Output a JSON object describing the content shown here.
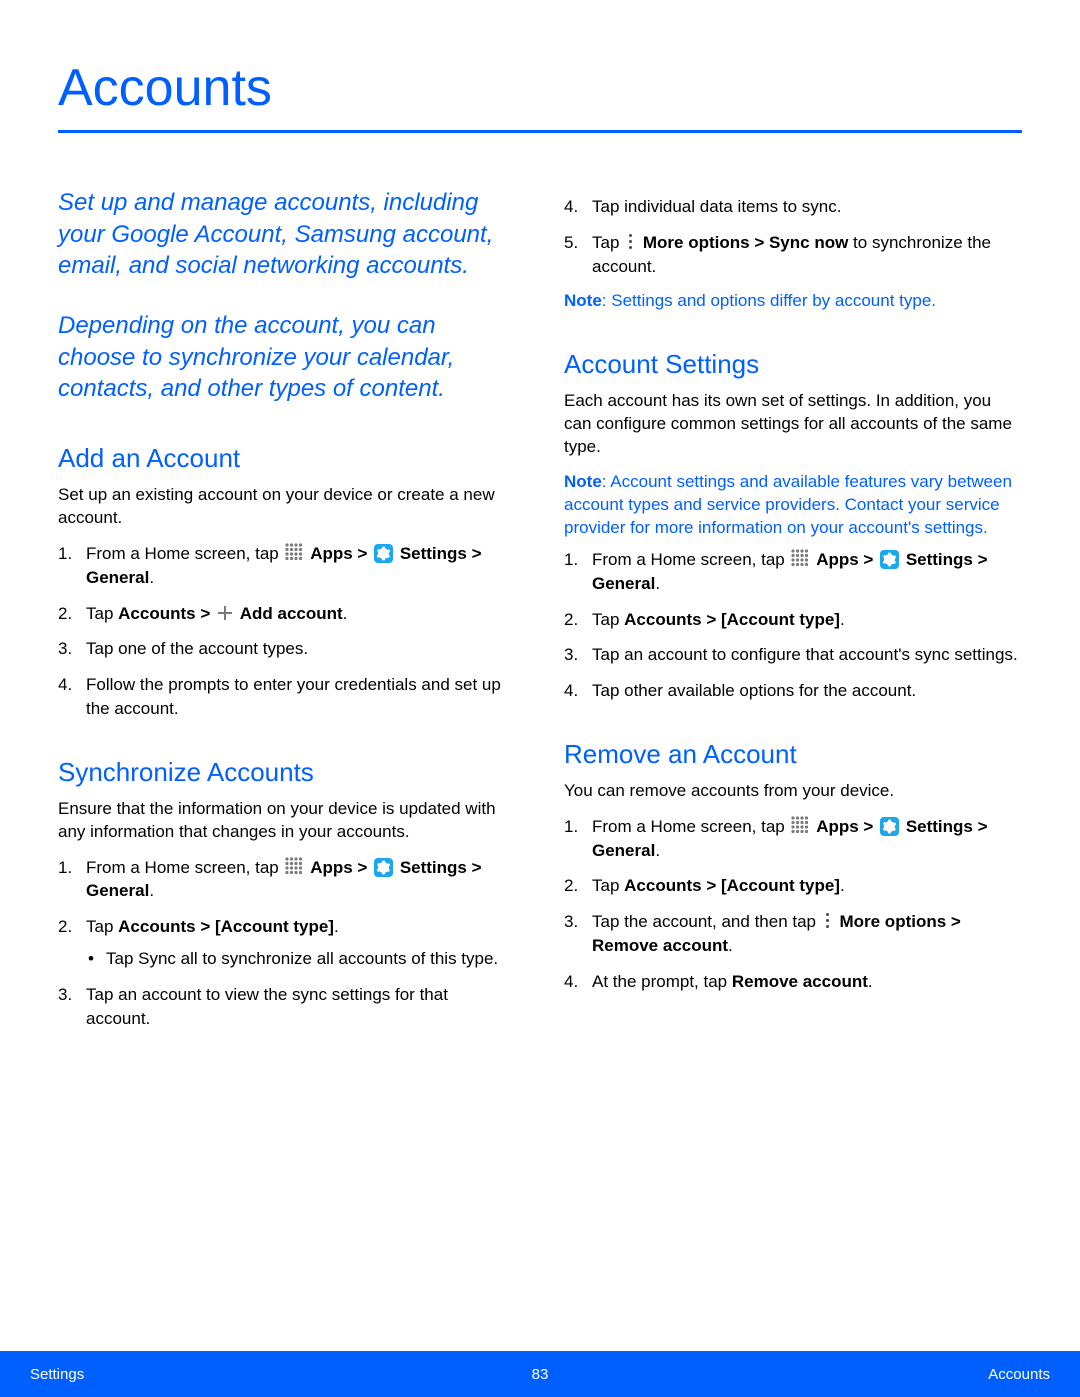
{
  "page": {
    "title": "Accounts",
    "intro1": "Set up and manage accounts, including your Google Account, Samsung account, email, and social networking accounts.",
    "intro2": "Depending on the account, you can choose to synchronize your calendar, contacts, and other types of content."
  },
  "left": {
    "add": {
      "heading": "Add an Account",
      "lead": "Set up an existing account on your device or create a new account.",
      "s1_a": "From a Home screen, tap ",
      "s1_b": " Apps > ",
      "s1_c": " Settings > General",
      "s1_d": ".",
      "s2_a": "Tap ",
      "s2_b": "Accounts > ",
      "s2_c": " Add account",
      "s2_d": ".",
      "s3": "Tap one of the account types.",
      "s4": "Follow the prompts to enter your credentials and set up the account."
    },
    "sync": {
      "heading": "Synchronize Accounts",
      "lead": "Ensure that the information on your device is updated with any information that changes in your accounts.",
      "s1_a": "From a Home screen, tap ",
      "s1_b": " Apps > ",
      "s1_c": " Settings > General",
      "s1_d": ".",
      "s2_a": "Tap ",
      "s2_b": "Accounts > [Account type]",
      "s2_c": ".",
      "s2_sub": "Tap Sync all to synchronize all accounts of this type.",
      "s3": "Tap an account to view the sync settings for that account."
    }
  },
  "right": {
    "sync_cont": {
      "s4": "Tap individual data items to sync.",
      "s5_a": "Tap ",
      "s5_b": " More options > Sync now",
      "s5_c": " to synchronize the account.",
      "note_label": "Note",
      "note_text": ": Settings and options differ by account type."
    },
    "acct_settings": {
      "heading": "Account Settings",
      "lead": "Each account has its own set of settings. In addition, you can configure common settings for all accounts of the same type.",
      "note_label": "Note",
      "note_text": ": Account settings and available features vary between account types and service providers. Contact your service provider for more information on your account's settings.",
      "s1_a": "From a Home screen, tap ",
      "s1_b": " Apps > ",
      "s1_c": " Settings > General",
      "s1_d": ".",
      "s2_a": "Tap ",
      "s2_b": "Accounts > [Account type]",
      "s2_c": ".",
      "s3": "Tap an account to configure that account's sync settings.",
      "s4": "Tap other available options for the account."
    },
    "remove": {
      "heading": "Remove an Account",
      "lead": "You can remove accounts from your device.",
      "s1_a": "From a Home screen, tap ",
      "s1_b": " Apps > ",
      "s1_c": " Settings > General",
      "s1_d": ".",
      "s2_a": "Tap ",
      "s2_b": "Accounts > [Account type]",
      "s2_c": ".",
      "s3_a": "Tap the account, and then tap ",
      "s3_b": " More options > Remove account",
      "s3_c": ".",
      "s4_a": "At the prompt, tap ",
      "s4_b": "Remove account",
      "s4_c": "."
    }
  },
  "footer": {
    "left": "Settings",
    "center": "83",
    "right": "Accounts"
  }
}
